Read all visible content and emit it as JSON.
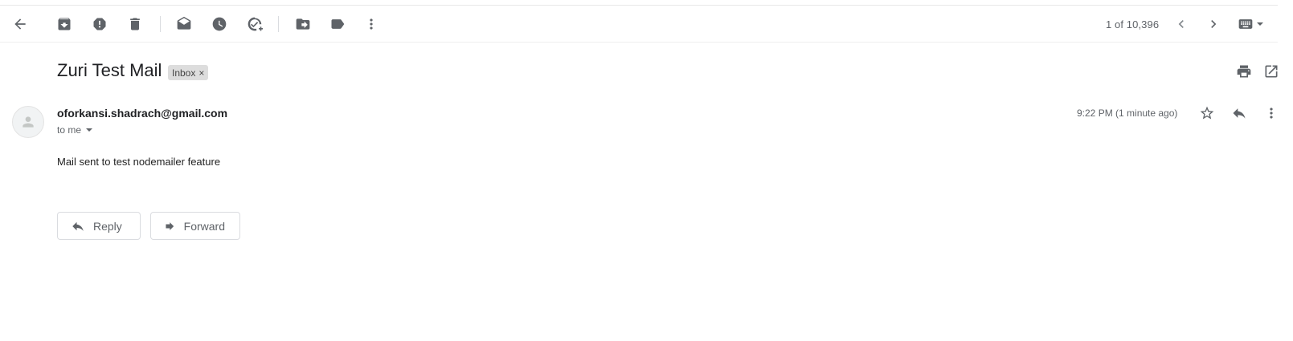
{
  "toolbar": {
    "back": "back-arrow-icon",
    "archive": "archive-icon",
    "spam": "report-spam-icon",
    "delete": "trash-icon",
    "mark_unread": "mark-unread-icon",
    "snooze": "snooze-clock-icon",
    "add_task": "add-task-icon",
    "move_to": "move-to-folder-icon",
    "labels": "label-icon",
    "more": "more-vertical-icon",
    "pager": "1 of 10,396",
    "keyboard": "keyboard-icon"
  },
  "email": {
    "subject": "Zuri Test Mail",
    "label": "Inbox",
    "label_remove": "×",
    "sender": "oforkansi.shadrach@gmail.com",
    "recipient_line": "to me",
    "timestamp": "9:22 PM (1 minute ago)",
    "body": "Mail sent to test nodemailer feature"
  },
  "actions": {
    "reply_label": "Reply",
    "forward_label": "Forward"
  },
  "colors": {
    "icon": "#5f6368",
    "chip_bg": "#dddddd",
    "border": "#dadce0"
  }
}
